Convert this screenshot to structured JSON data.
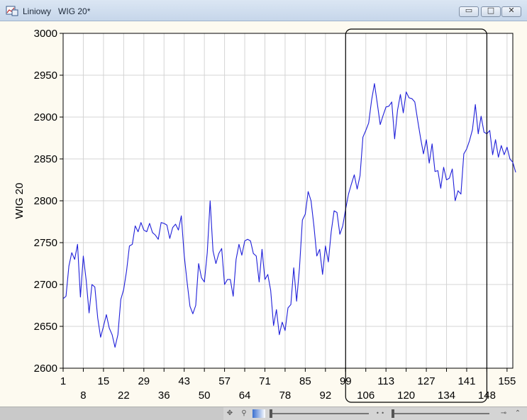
{
  "window": {
    "app_name": "Liniowy",
    "doc_title": "WIG 20*",
    "icons": {
      "app": "chart-app-icon",
      "minimize": "minimize-icon",
      "maximize": "maximize-icon",
      "close": "close-icon"
    },
    "minimize_glyph": "▭",
    "maximize_glyph": "□",
    "close_glyph": "✕"
  },
  "status_bar": {
    "icons": [
      "navigate-icon",
      "zoom-icon",
      "color-scale-icon",
      "horizontal-scroll-icon",
      "vertical-scroll-icon",
      "expand-icon"
    ],
    "glyphs": {
      "navigate": "✥",
      "zoom": "⚲",
      "expand": "⌃"
    }
  },
  "colors": {
    "line": "#1f1fd9",
    "grid": "#d4d4d4",
    "plot_bg": "#ffffff",
    "page_bg": "#fdfaf0"
  },
  "chart_data": {
    "type": "line",
    "title": "",
    "xlabel": "",
    "ylabel": "WIG 20",
    "xlim": [
      1,
      157
    ],
    "ylim": [
      2600,
      3000
    ],
    "grid": true,
    "legend": "none",
    "yticks": [
      2600,
      2650,
      2700,
      2750,
      2800,
      2850,
      2900,
      2950,
      3000
    ],
    "xticks_top": [
      1,
      15,
      29,
      43,
      57,
      71,
      85,
      99,
      113,
      127,
      141,
      155
    ],
    "xticks_bottom": [
      8,
      22,
      36,
      50,
      64,
      78,
      92,
      106,
      120,
      134,
      148
    ],
    "highlight_range": [
      99,
      148
    ],
    "series": [
      {
        "values": [
          2683,
          2686,
          2722,
          2738,
          2730,
          2748,
          2685,
          2734,
          2705,
          2666,
          2700,
          2697,
          2660,
          2637,
          2650,
          2664,
          2648,
          2640,
          2625,
          2640,
          2682,
          2694,
          2716,
          2746,
          2748,
          2770,
          2763,
          2774,
          2765,
          2763,
          2773,
          2762,
          2759,
          2754,
          2774,
          2773,
          2771,
          2755,
          2768,
          2772,
          2765,
          2782,
          2735,
          2703,
          2674,
          2665,
          2675,
          2725,
          2708,
          2703,
          2738,
          2800,
          2740,
          2725,
          2737,
          2743,
          2700,
          2706,
          2706,
          2686,
          2730,
          2748,
          2735,
          2752,
          2754,
          2752,
          2737,
          2734,
          2703,
          2742,
          2706,
          2712,
          2693,
          2651,
          2670,
          2640,
          2655,
          2645,
          2672,
          2676,
          2720,
          2680,
          2720,
          2777,
          2784,
          2811,
          2800,
          2770,
          2734,
          2742,
          2712,
          2746,
          2727,
          2763,
          2788,
          2786,
          2760,
          2770,
          2790,
          2808,
          2820,
          2831,
          2814,
          2830,
          2876,
          2884,
          2893,
          2920,
          2940,
          2916,
          2891,
          2902,
          2912,
          2913,
          2918,
          2874,
          2908,
          2927,
          2905,
          2930,
          2923,
          2922,
          2918,
          2896,
          2875,
          2856,
          2873,
          2845,
          2868,
          2835,
          2836,
          2815,
          2840,
          2825,
          2827,
          2838,
          2800,
          2812,
          2808,
          2856,
          2862,
          2872,
          2885,
          2915,
          2880,
          2901,
          2882,
          2880,
          2884,
          2855,
          2873,
          2852,
          2866,
          2855,
          2864,
          2850,
          2846,
          2834
        ]
      }
    ]
  }
}
